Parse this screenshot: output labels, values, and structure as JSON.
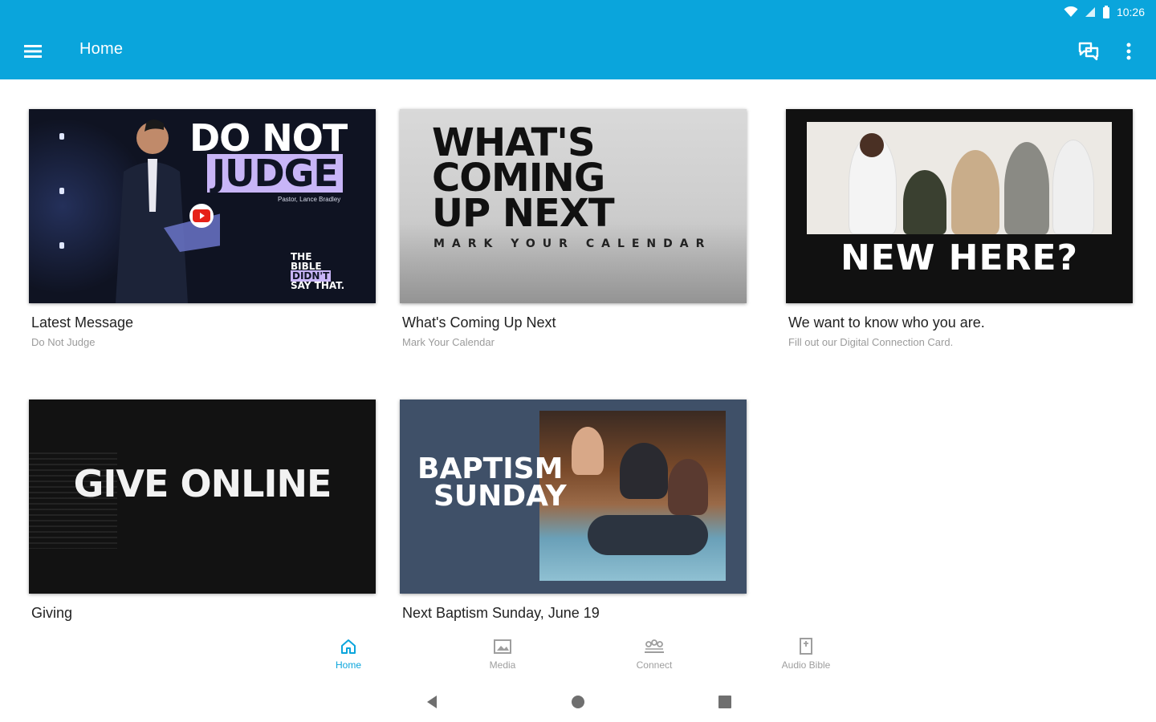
{
  "status_bar": {
    "time": "10:26"
  },
  "app_bar": {
    "title": "Home",
    "menu_icon": "hamburger-menu-icon",
    "chat_icon": "chat-bubbles-icon",
    "more_icon": "more-vert-icon",
    "color": "#0aa5dc"
  },
  "cards": [
    {
      "title": "Latest Message",
      "subtitle": "Do Not Judge",
      "thumb": {
        "line1": "DO NOT",
        "line2": "JUDGE",
        "byline": "Pastor, Lance Bradley",
        "series_1": "THE",
        "series_2": "BIBLE",
        "series_3": "DIDN'T",
        "series_4": "SAY THAT."
      }
    },
    {
      "title": "What's Coming Up Next",
      "subtitle": "Mark Your Calendar",
      "thumb": {
        "line1": "WHAT'S",
        "line2": "COMING",
        "line3": "UP NEXT",
        "tagline": "MARK YOUR CALENDAR"
      }
    },
    {
      "title": "We want to know who you are.",
      "subtitle": "Fill out our Digital Connection Card.",
      "thumb": {
        "headline": "NEW HERE?"
      }
    },
    {
      "title": "Giving",
      "subtitle": "",
      "thumb": {
        "headline": "GIVE ONLINE"
      }
    },
    {
      "title": "Next Baptism Sunday, June 19",
      "subtitle": "",
      "thumb": {
        "line1": "BAPTISM",
        "line2": "SUNDAY"
      }
    }
  ],
  "bottom_nav": [
    {
      "label": "Home",
      "icon": "home-icon",
      "active": true
    },
    {
      "label": "Media",
      "icon": "media-icon",
      "active": false
    },
    {
      "label": "Connect",
      "icon": "connect-icon",
      "active": false
    },
    {
      "label": "Audio Bible",
      "icon": "audio-bible-icon",
      "active": false
    }
  ],
  "colors": {
    "accent": "#0aa5dc",
    "lavender": "#c8b5f7"
  }
}
